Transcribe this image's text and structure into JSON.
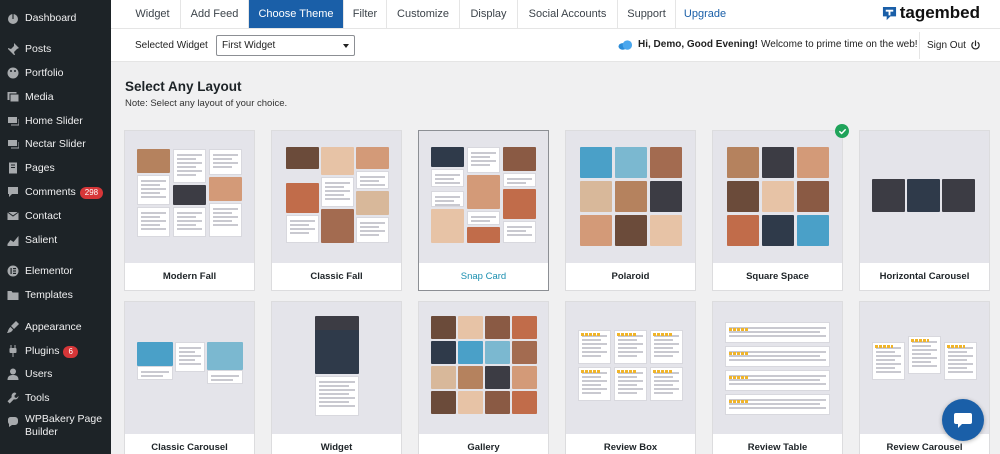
{
  "sidebar": {
    "items": [
      {
        "label": "Dashboard",
        "icon": "dashboard-icon"
      },
      {
        "label": "Posts",
        "icon": "pin-icon"
      },
      {
        "label": "Portfolio",
        "icon": "palette-icon"
      },
      {
        "label": "Media",
        "icon": "media-icon"
      },
      {
        "label": "Home Slider",
        "icon": "slider-icon"
      },
      {
        "label": "Nectar Slider",
        "icon": "slider-icon"
      },
      {
        "label": "Pages",
        "icon": "page-icon"
      },
      {
        "label": "Comments",
        "icon": "comment-icon",
        "badge": "298"
      },
      {
        "label": "Contact",
        "icon": "mail-icon"
      },
      {
        "label": "Salient",
        "icon": "chart-icon"
      },
      {
        "label": "Elementor",
        "icon": "elementor-icon"
      },
      {
        "label": "Templates",
        "icon": "folder-icon"
      },
      {
        "label": "Appearance",
        "icon": "brush-icon"
      },
      {
        "label": "Plugins",
        "icon": "plug-icon",
        "badge": "6"
      },
      {
        "label": "Users",
        "icon": "user-icon"
      },
      {
        "label": "Tools",
        "icon": "wrench-icon"
      },
      {
        "label": "WPBakery Page Builder",
        "icon": "wpbakery-icon"
      }
    ]
  },
  "tabs": [
    "Widget",
    "Add Feed",
    "Choose Theme",
    "Filter",
    "Customize",
    "Display",
    "Social Accounts",
    "Support",
    "Upgrade"
  ],
  "active_tab": "Choose Theme",
  "brand": {
    "name": "tagembed",
    "color": "#1a5fa8"
  },
  "subbar": {
    "selected_widget_label": "Selected Widget",
    "selected_widget_value": "First Widget",
    "greeting_bold": "Hi, Demo, Good Evening!",
    "greeting_text": "Welcome to prime time on the web!",
    "sign_out": "Sign Out"
  },
  "main": {
    "heading": "Select Any Layout",
    "note": "Note: Select any layout of your choice."
  },
  "layouts": [
    {
      "name": "Modern Fall",
      "style": "masonry-mixed"
    },
    {
      "name": "Classic Fall",
      "style": "masonry-photos"
    },
    {
      "name": "Snap Card",
      "style": "snap",
      "selected": true
    },
    {
      "name": "Polaroid",
      "style": "grid-photos"
    },
    {
      "name": "Square Space",
      "style": "grid-dark",
      "checked": true
    },
    {
      "name": "Horizontal Carousel",
      "style": "horizontal-dark"
    },
    {
      "name": "Classic Carousel",
      "style": "carousel"
    },
    {
      "name": "Widget",
      "style": "widget"
    },
    {
      "name": "Gallery",
      "style": "gallery"
    },
    {
      "name": "Review Box",
      "style": "review-box"
    },
    {
      "name": "Review Table",
      "style": "review-table"
    },
    {
      "name": "Review Carousel",
      "style": "review-carousel"
    }
  ],
  "colors": {
    "sidebar_bg": "#1d2327",
    "accent": "#1a5fa8",
    "check": "#1fa35a",
    "badge": "#d63638"
  }
}
